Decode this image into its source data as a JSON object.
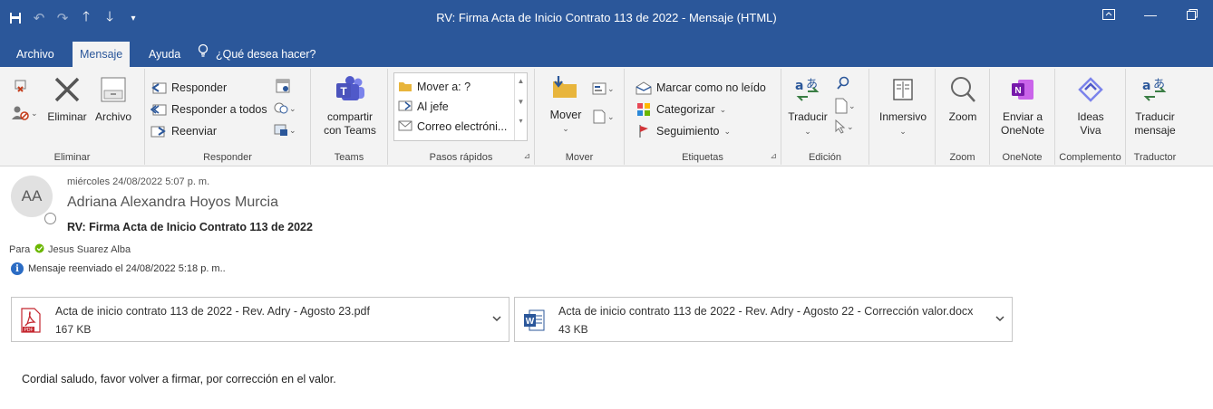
{
  "window": {
    "title": "RV: Firma Acta de Inicio Contrato 113 de 2022  -  Mensaje (HTML)"
  },
  "qat": {
    "icons": [
      "save-icon",
      "undo-icon",
      "redo-icon",
      "up-arrow-icon",
      "down-arrow-icon",
      "customize-icon"
    ]
  },
  "tabs": [
    {
      "label": "Archivo"
    },
    {
      "label": "Mensaje"
    },
    {
      "label": "Ayuda"
    }
  ],
  "tellme": {
    "label": "¿Qué desea hacer?"
  },
  "ribbon": {
    "eliminar": {
      "group": "Eliminar",
      "delete_label": "Eliminar",
      "archive_label": "Archivo"
    },
    "responder": {
      "group": "Responder",
      "reply": "Responder",
      "reply_all": "Responder a todos",
      "forward": "Reenviar"
    },
    "teams": {
      "group": "Teams",
      "share_line1": "compartir",
      "share_line2": "con Teams"
    },
    "quicksteps": {
      "group": "Pasos rápidos",
      "items": [
        "Mover a: ?",
        "Al jefe",
        "Correo electróni..."
      ]
    },
    "mover": {
      "group": "Mover",
      "move_label": "Mover"
    },
    "etiquetas": {
      "group": "Etiquetas",
      "unread": "Marcar como no leído",
      "categorize": "Categorizar",
      "followup": "Seguimiento"
    },
    "edicion": {
      "group": "Edición",
      "translate": "Traducir"
    },
    "inmersivo": {
      "label": "Inmersivo"
    },
    "zoom": {
      "group": "Zoom",
      "label": "Zoom"
    },
    "onenote": {
      "group": "OneNote",
      "line1": "Enviar a",
      "line2": "OneNote"
    },
    "complemento": {
      "group": "Complemento",
      "line1": "Ideas",
      "line2": "Viva"
    },
    "traductor": {
      "group": "Traductor",
      "line1": "Traducir",
      "line2": "mensaje"
    }
  },
  "message": {
    "avatar_initials": "AA",
    "date": "miércoles 24/08/2022 5:07 p. m.",
    "sender": "Adriana Alexandra Hoyos Murcia",
    "subject": "RV: Firma Acta de Inicio Contrato 113 de 2022",
    "to_label": "Para",
    "recipient": "Jesus Suarez Alba",
    "forward_note": "Mensaje reenviado el 24/08/2022 5:18 p. m..",
    "body": "Cordial saludo, favor volver a firmar, por corrección en el valor."
  },
  "attachments": [
    {
      "name": "Acta de inicio contrato  113 de 2022 - Rev. Adry - Agosto 23.pdf",
      "size": "167 KB",
      "icon": "pdf-file-icon"
    },
    {
      "name": "Acta de inicio contrato  113 de 2022 - Rev. Adry - Agosto 22 - Corrección valor.docx",
      "size": "43 KB",
      "icon": "word-file-icon"
    }
  ],
  "colors": {
    "accent": "#2b579a",
    "ribbon_bg": "#f3f3f3",
    "presence_green": "#6bb700"
  }
}
